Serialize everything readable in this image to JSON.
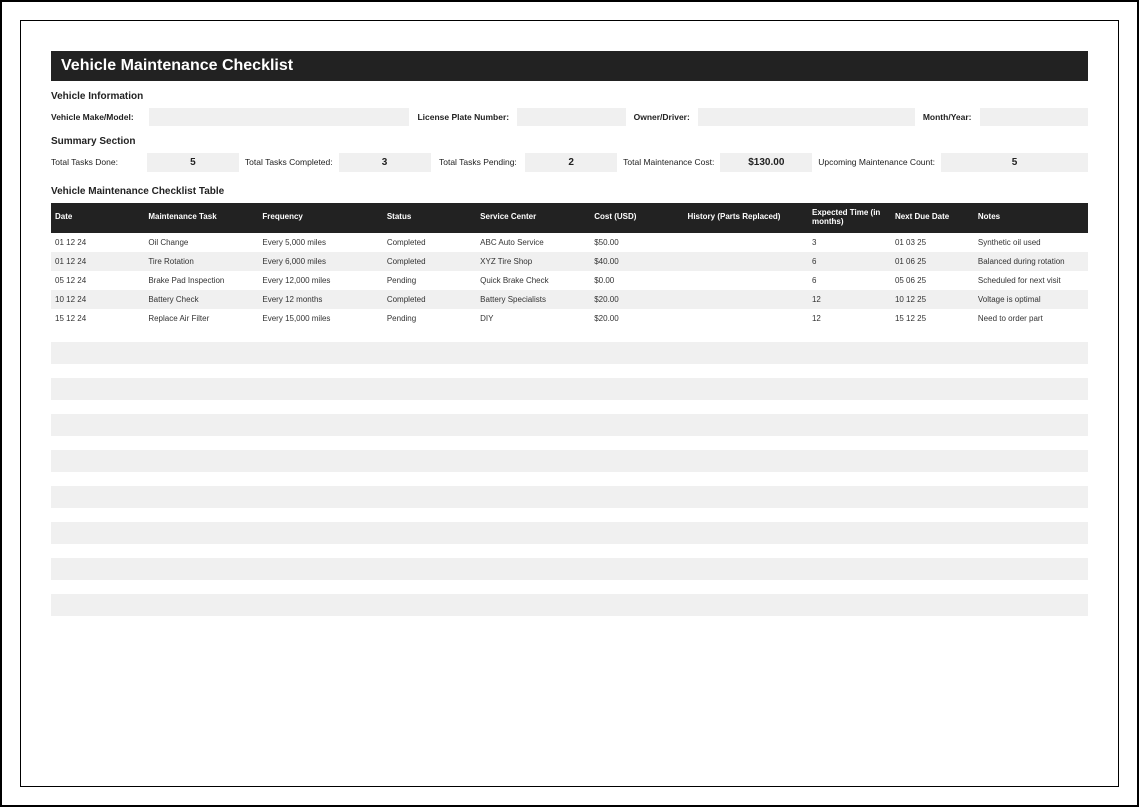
{
  "title": "Vehicle Maintenance Checklist",
  "sections": {
    "vehicle_info_label": "Vehicle Information",
    "summary_label": "Summary Section",
    "table_label": "Vehicle Maintenance Checklist Table"
  },
  "vehicle_info": {
    "make_model_label": "Vehicle Make/Model:",
    "make_model_value": "",
    "plate_label": "License Plate Number:",
    "plate_value": "",
    "owner_label": "Owner/Driver:",
    "owner_value": "",
    "month_year_label": "Month/Year:",
    "month_year_value": ""
  },
  "summary": {
    "tasks_done_label": "Total Tasks Done:",
    "tasks_done_value": "5",
    "tasks_completed_label": "Total Tasks Completed:",
    "tasks_completed_value": "3",
    "tasks_pending_label": "Total Tasks Pending:",
    "tasks_pending_value": "2",
    "maintenance_cost_label": "Total Maintenance Cost:",
    "maintenance_cost_value": "$130.00",
    "upcoming_label": "Upcoming Maintenance Count:",
    "upcoming_value": "5"
  },
  "table": {
    "headers": {
      "date": "Date",
      "task": "Maintenance Task",
      "frequency": "Frequency",
      "status": "Status",
      "service_center": "Service Center",
      "cost": "Cost (USD)",
      "history": "History (Parts Replaced)",
      "expected_time": "Expected Time (in months)",
      "next_due": "Next Due Date",
      "notes": "Notes"
    },
    "rows": [
      {
        "date": "01 12 24",
        "task": "Oil Change",
        "frequency": "Every 5,000 miles",
        "status": "Completed",
        "service_center": "ABC Auto Service",
        "cost": "$50.00",
        "history": "",
        "expected_time": "3",
        "next_due": "01 03 25",
        "notes": "Synthetic oil used"
      },
      {
        "date": "01 12 24",
        "task": "Tire Rotation",
        "frequency": "Every 6,000 miles",
        "status": "Completed",
        "service_center": "XYZ Tire Shop",
        "cost": "$40.00",
        "history": "",
        "expected_time": "6",
        "next_due": "01 06 25",
        "notes": "Balanced during rotation"
      },
      {
        "date": "05 12 24",
        "task": "Brake Pad Inspection",
        "frequency": "Every 12,000 miles",
        "status": "Pending",
        "service_center": "Quick Brake Check",
        "cost": "$0.00",
        "history": "",
        "expected_time": "6",
        "next_due": "05 06 25",
        "notes": "Scheduled for next visit"
      },
      {
        "date": "10 12 24",
        "task": "Battery Check",
        "frequency": "Every 12 months",
        "status": "Completed",
        "service_center": "Battery Specialists",
        "cost": "$20.00",
        "history": "",
        "expected_time": "12",
        "next_due": "10 12 25",
        "notes": "Voltage is optimal"
      },
      {
        "date": "15 12 24",
        "task": "Replace Air Filter",
        "frequency": "Every 15,000 miles",
        "status": "Pending",
        "service_center": "DIY",
        "cost": "$20.00",
        "history": "",
        "expected_time": "12",
        "next_due": "15 12 25",
        "notes": "Need to order part"
      }
    ]
  }
}
